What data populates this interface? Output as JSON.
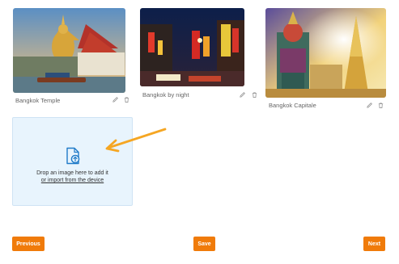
{
  "gallery": {
    "items": [
      {
        "caption": "Bangkok Temple",
        "edit_icon": "pencil-icon",
        "delete_icon": "trash-icon"
      },
      {
        "caption": "Bangkok by night",
        "edit_icon": "pencil-icon",
        "delete_icon": "trash-icon"
      },
      {
        "caption": "Bangkok Capitale",
        "edit_icon": "pencil-icon",
        "delete_icon": "trash-icon"
      }
    ]
  },
  "dropzone": {
    "icon": "file-upload-icon",
    "text": "Drop an image here to add it",
    "link": "or import from the device"
  },
  "annotation": {
    "icon": "arrow-pointer-icon",
    "color": "#f5a623"
  },
  "footer": {
    "previous_label": "Previous",
    "save_label": "Save",
    "next_label": "Next",
    "button_color": "#f07b0a"
  }
}
